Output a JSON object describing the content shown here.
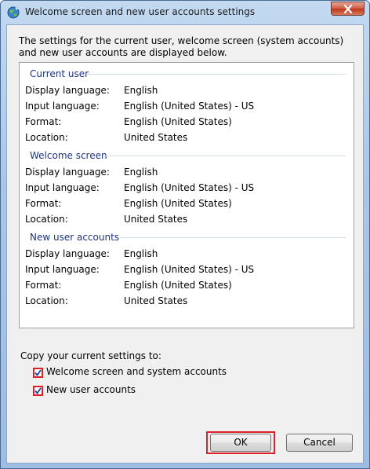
{
  "window": {
    "title": "Welcome screen and new user accounts settings",
    "close_icon": "close-icon",
    "app_icon": "globe-icon"
  },
  "intro_text": "The settings for the current user, welcome screen (system accounts) and new user accounts are displayed below.",
  "sections": [
    {
      "heading": "Current user",
      "rows": [
        {
          "label": "Display language:",
          "value": "English"
        },
        {
          "label": "Input language:",
          "value": "English (United States) - US"
        },
        {
          "label": "Format:",
          "value": "English (United States)"
        },
        {
          "label": "Location:",
          "value": "United States"
        }
      ]
    },
    {
      "heading": "Welcome screen",
      "rows": [
        {
          "label": "Display language:",
          "value": "English"
        },
        {
          "label": "Input language:",
          "value": "English (United States) - US"
        },
        {
          "label": "Format:",
          "value": "English (United States)"
        },
        {
          "label": "Location:",
          "value": "United States"
        }
      ]
    },
    {
      "heading": "New user accounts",
      "rows": [
        {
          "label": "Display language:",
          "value": "English"
        },
        {
          "label": "Input language:",
          "value": "English (United States) - US"
        },
        {
          "label": "Format:",
          "value": "English (United States)"
        },
        {
          "label": "Location:",
          "value": "United States"
        }
      ]
    }
  ],
  "copy": {
    "label": "Copy your current settings to:",
    "options": [
      {
        "label": "Welcome screen and system accounts",
        "checked": true
      },
      {
        "label": "New user accounts",
        "checked": true
      }
    ]
  },
  "buttons": {
    "ok": "OK",
    "cancel": "Cancel"
  },
  "colors": {
    "highlight": "#d8232a",
    "section_heading": "#1e3287"
  }
}
